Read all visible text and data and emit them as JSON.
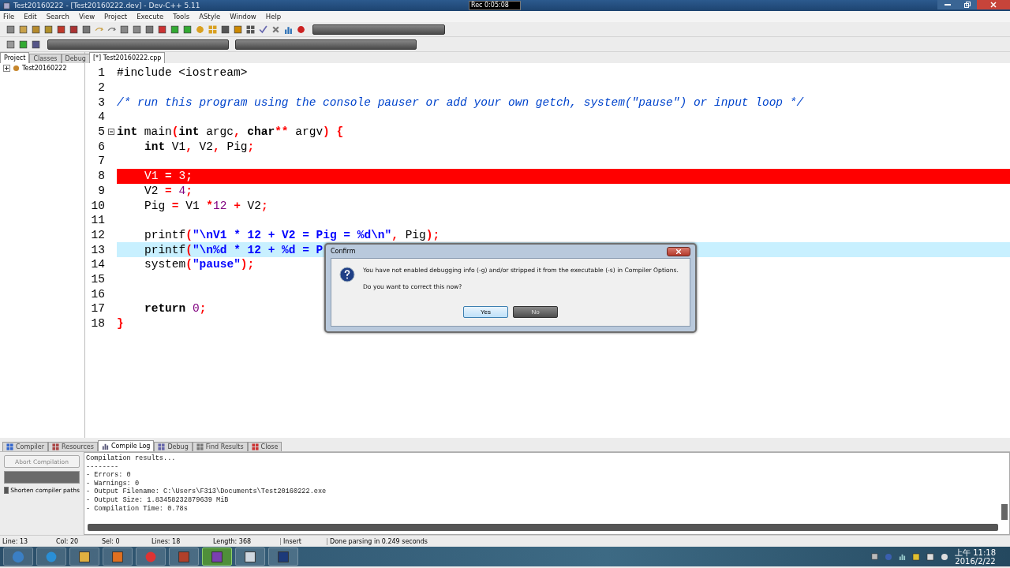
{
  "window": {
    "title": "Test20160222 - [Test20160222.dev] - Dev-C++ 5.11"
  },
  "recorder": {
    "time": "Rec 0:05:08"
  },
  "menu": [
    "File",
    "Edit",
    "Search",
    "View",
    "Project",
    "Execute",
    "Tools",
    "AStyle",
    "Window",
    "Help"
  ],
  "side_tabs": [
    {
      "label": "Project",
      "selected": true
    },
    {
      "label": "Classes",
      "selected": false
    },
    {
      "label": "Debug",
      "selected": false
    }
  ],
  "project_tree": [
    {
      "label": "Test20160222",
      "expanded": false
    }
  ],
  "editor_tabs": [
    {
      "label": "[*] Test20160222.cpp",
      "selected": true
    }
  ],
  "code_lines": [
    {
      "number": "1",
      "kind": "normal",
      "indent": false,
      "tokens": [
        {
          "kind": "pre",
          "t": "#include <iostream>"
        }
      ]
    },
    {
      "number": "2",
      "kind": "normal"
    },
    {
      "number": "3",
      "kind": "normal",
      "indent": false,
      "tokens": [
        {
          "kind": "comment",
          "t": "/* run this program using the console pauser or add your own getch, system(\"pause\") or input loop */"
        }
      ]
    },
    {
      "number": "4",
      "kind": "normal"
    },
    {
      "number": "5",
      "kind": "normal",
      "indent": false,
      "fold": true,
      "tokens": [
        {
          "kind": "kw",
          "t": "int"
        },
        {
          "kind": "plain",
          "t": " main"
        },
        {
          "kind": "sym",
          "t": "("
        },
        {
          "kind": "kw",
          "t": "int"
        },
        {
          "kind": "plain",
          "t": " argc"
        },
        {
          "kind": "sym",
          "t": ", "
        },
        {
          "kind": "kw",
          "t": "char"
        },
        {
          "kind": "sym",
          "t": "**"
        },
        {
          "kind": "plain",
          "t": " argv"
        },
        {
          "kind": "sym",
          "t": ") {"
        }
      ]
    },
    {
      "number": "6",
      "kind": "normal",
      "indent": true,
      "tokens": [
        {
          "kind": "kw",
          "t": "int"
        },
        {
          "kind": "plain",
          "t": " V1"
        },
        {
          "kind": "sym",
          "t": ","
        },
        {
          "kind": "plain",
          "t": " V2"
        },
        {
          "kind": "sym",
          "t": ","
        },
        {
          "kind": "plain",
          "t": " Pig"
        },
        {
          "kind": "sym",
          "t": ";"
        }
      ]
    },
    {
      "number": "7",
      "kind": "normal"
    },
    {
      "number": "8",
      "kind": "breakpoint",
      "indent": true,
      "tokens": [
        {
          "kind": "plain",
          "t": "V1 "
        },
        {
          "kind": "sym",
          "t": "="
        },
        {
          "kind": "num",
          "t": " 3"
        },
        {
          "kind": "sym",
          "t": ";"
        }
      ]
    },
    {
      "number": "9",
      "kind": "normal",
      "indent": true,
      "tokens": [
        {
          "kind": "plain",
          "t": "V2 "
        },
        {
          "kind": "sym",
          "t": "="
        },
        {
          "kind": "num",
          "t": " 4"
        },
        {
          "kind": "sym",
          "t": ";"
        }
      ]
    },
    {
      "number": "10",
      "kind": "normal",
      "indent": true,
      "tokens": [
        {
          "kind": "plain",
          "t": "Pig "
        },
        {
          "kind": "sym",
          "t": "="
        },
        {
          "kind": "plain",
          "t": " V1 "
        },
        {
          "kind": "sym",
          "t": "*"
        },
        {
          "kind": "num",
          "t": "12"
        },
        {
          "kind": "sym",
          "t": " +"
        },
        {
          "kind": "plain",
          "t": " V2"
        },
        {
          "kind": "sym",
          "t": ";"
        }
      ]
    },
    {
      "number": "11",
      "kind": "normal"
    },
    {
      "number": "12",
      "kind": "normal",
      "indent": true,
      "tokens": [
        {
          "kind": "plain",
          "t": "printf"
        },
        {
          "kind": "sym",
          "t": "("
        },
        {
          "kind": "str",
          "t": "\"\\nV1 * 12 + V2 = Pig = %d\\n\""
        },
        {
          "kind": "sym",
          "t": ","
        },
        {
          "kind": "plain",
          "t": " Pig"
        },
        {
          "kind": "sym",
          "t": ");"
        }
      ]
    },
    {
      "number": "13",
      "kind": "current",
      "indent": true,
      "tokens": [
        {
          "kind": "plain",
          "t": "printf"
        },
        {
          "kind": "sym",
          "t": "("
        },
        {
          "kind": "str",
          "t": "\"\\n%d * 12 + %d = P"
        }
      ]
    },
    {
      "number": "14",
      "kind": "normal",
      "indent": true,
      "tokens": [
        {
          "kind": "plain",
          "t": "system"
        },
        {
          "kind": "sym",
          "t": "("
        },
        {
          "kind": "str",
          "t": "\"pause\""
        },
        {
          "kind": "sym",
          "t": ");"
        }
      ]
    },
    {
      "number": "15",
      "kind": "normal"
    },
    {
      "number": "16",
      "kind": "normal"
    },
    {
      "number": "17",
      "kind": "normal",
      "indent": true,
      "tokens": [
        {
          "kind": "kw",
          "t": "return"
        },
        {
          "kind": "num",
          "t": " 0"
        },
        {
          "kind": "sym",
          "t": ";"
        }
      ]
    },
    {
      "number": "18",
      "kind": "normal",
      "indent": false,
      "tokens": [
        {
          "kind": "sym",
          "t": "}"
        }
      ]
    }
  ],
  "dialog": {
    "title": "Confirm",
    "message": "You have not enabled debugging info (-g) and/or stripped it from the executable (-s) in Compiler Options.",
    "question": "Do you want to correct this now?",
    "buttons": [
      {
        "label": "Yes",
        "selected": true
      },
      {
        "label": "No",
        "selected": false
      }
    ]
  },
  "bottom_tabs": [
    {
      "label": "Compiler",
      "selected": false
    },
    {
      "label": "Resources",
      "selected": false
    },
    {
      "label": "Compile Log",
      "selected": true
    },
    {
      "label": "Debug",
      "selected": false
    },
    {
      "label": "Find Results",
      "selected": false
    },
    {
      "label": "Close",
      "selected": false
    }
  ],
  "compile_panel": {
    "abort_button": {
      "label": "Abort Compilation",
      "disabled": true
    },
    "progress": {
      "level": 1
    },
    "shorten_paths": {
      "label": "Shorten compiler paths",
      "checked": true
    }
  },
  "compile_log": [
    "Compilation results...",
    "--------",
    "- Errors: 0",
    "- Warnings: 0",
    "- Output Filename: C:\\Users\\F313\\Documents\\Test20160222.exe",
    "- Output Size: 1.83458232879639 MiB",
    "- Compilation Time: 0.78s"
  ],
  "status_bar": [
    {
      "label": "Line:",
      "value": "13"
    },
    {
      "label": "Col:",
      "value": "20"
    },
    {
      "label": "Sel:",
      "value": "0"
    },
    {
      "label": "Lines:",
      "value": "18"
    },
    {
      "label": "Length:",
      "value": "368"
    },
    {
      "label": "Insert"
    },
    {
      "label": "Done parsing in 0.249 seconds"
    }
  ],
  "clock": {
    "time": "上午 11:18",
    "date": "2016/2/22"
  }
}
